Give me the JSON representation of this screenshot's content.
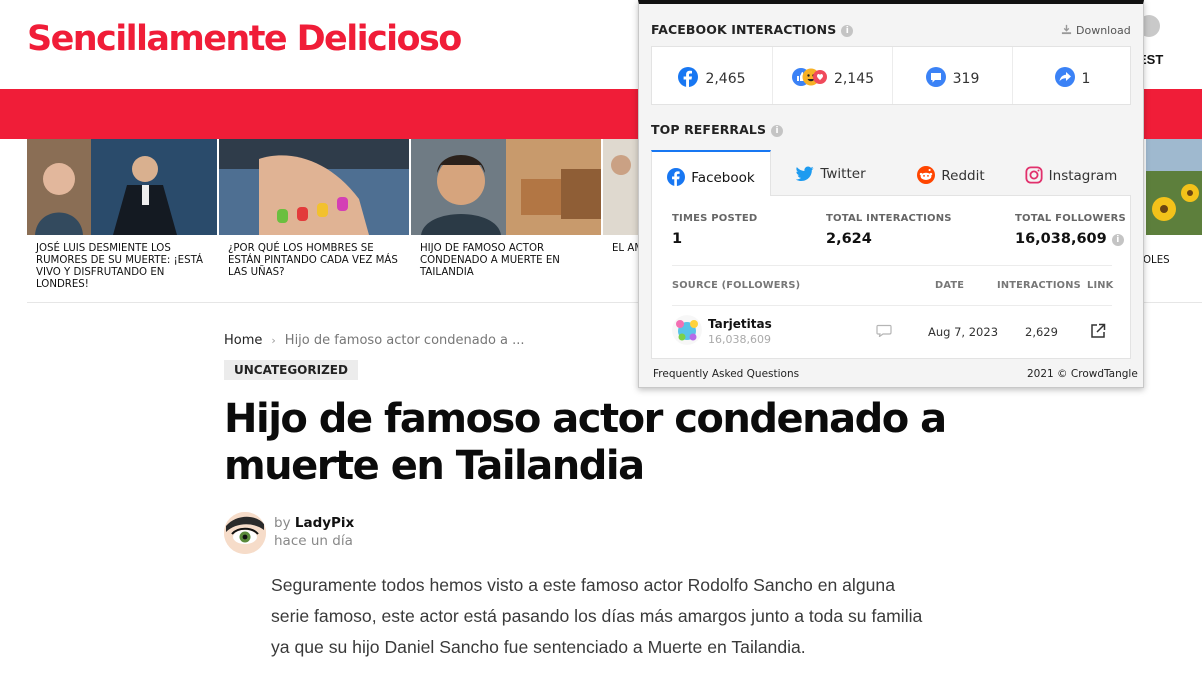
{
  "site": {
    "logo": "Sencillamente Delicioso",
    "header_right_label": "EST"
  },
  "carousel": {
    "items": [
      {
        "title": "José Luis desmiente los rumores de su muerte: ¡Está vivo y disfrutando en Londres!"
      },
      {
        "title": "¿Por qué los hombres se están pintando cada vez más las uñas?"
      },
      {
        "title": "Hijo de famoso actor condenado a muerte en Tailandia"
      },
      {
        "title": "El am Padr Leco Tribu"
      }
    ],
    "right_fragment": "OLES"
  },
  "article": {
    "breadcrumb_home": "Home",
    "breadcrumb_separator": "›",
    "breadcrumb_current": "Hijo de famoso actor condenado a ...",
    "category": "UNCATEGORIZED",
    "title": "Hijo de famoso actor condenado a muerte en Tailandia",
    "author_prefix": "by",
    "author_name": "LadyPix",
    "time": "hace un día",
    "body": "Seguramente todos hemos visto a este famoso actor Rodolfo Sancho en alguna serie famoso, este actor está pasando los días más amargos junto a toda su familia ya que su hijo Daniel Sancho fue sentenciado a Muerte en Tailandia."
  },
  "crowdtangle": {
    "interactions_title": "FACEBOOK INTERACTIONS",
    "download_label": "Download",
    "interactions": {
      "reactions": "2,465",
      "likes": "2,145",
      "comments": "319",
      "shares": "1"
    },
    "referrals_title": "TOP REFERRALS",
    "tabs": [
      {
        "label": "Facebook",
        "active": true
      },
      {
        "label": "Twitter",
        "active": false
      },
      {
        "label": "Reddit",
        "active": false
      },
      {
        "label": "Instagram",
        "active": false
      }
    ],
    "stats": {
      "times_posted_label": "TIMES POSTED",
      "times_posted": "1",
      "total_interactions_label": "TOTAL INTERACTIONS",
      "total_interactions": "2,624",
      "total_followers_label": "TOTAL FOLLOWERS",
      "total_followers": "16,038,609"
    },
    "table": {
      "col_source": "SOURCE (FOLLOWERS)",
      "col_date": "DATE",
      "col_interactions": "INTERACTIONS",
      "col_link": "LINK",
      "rows": [
        {
          "name": "Tarjetitas",
          "followers": "16,038,609",
          "date": "Aug 7, 2023",
          "interactions": "2,629"
        }
      ]
    },
    "footer_left": "Frequently Asked Questions",
    "footer_right": "2021 © CrowdTangle"
  },
  "colors": {
    "brand_red": "#f01d38",
    "facebook_blue": "#1877f2",
    "twitter_blue": "#1d9bf0",
    "reddit_orange": "#ff4500"
  }
}
